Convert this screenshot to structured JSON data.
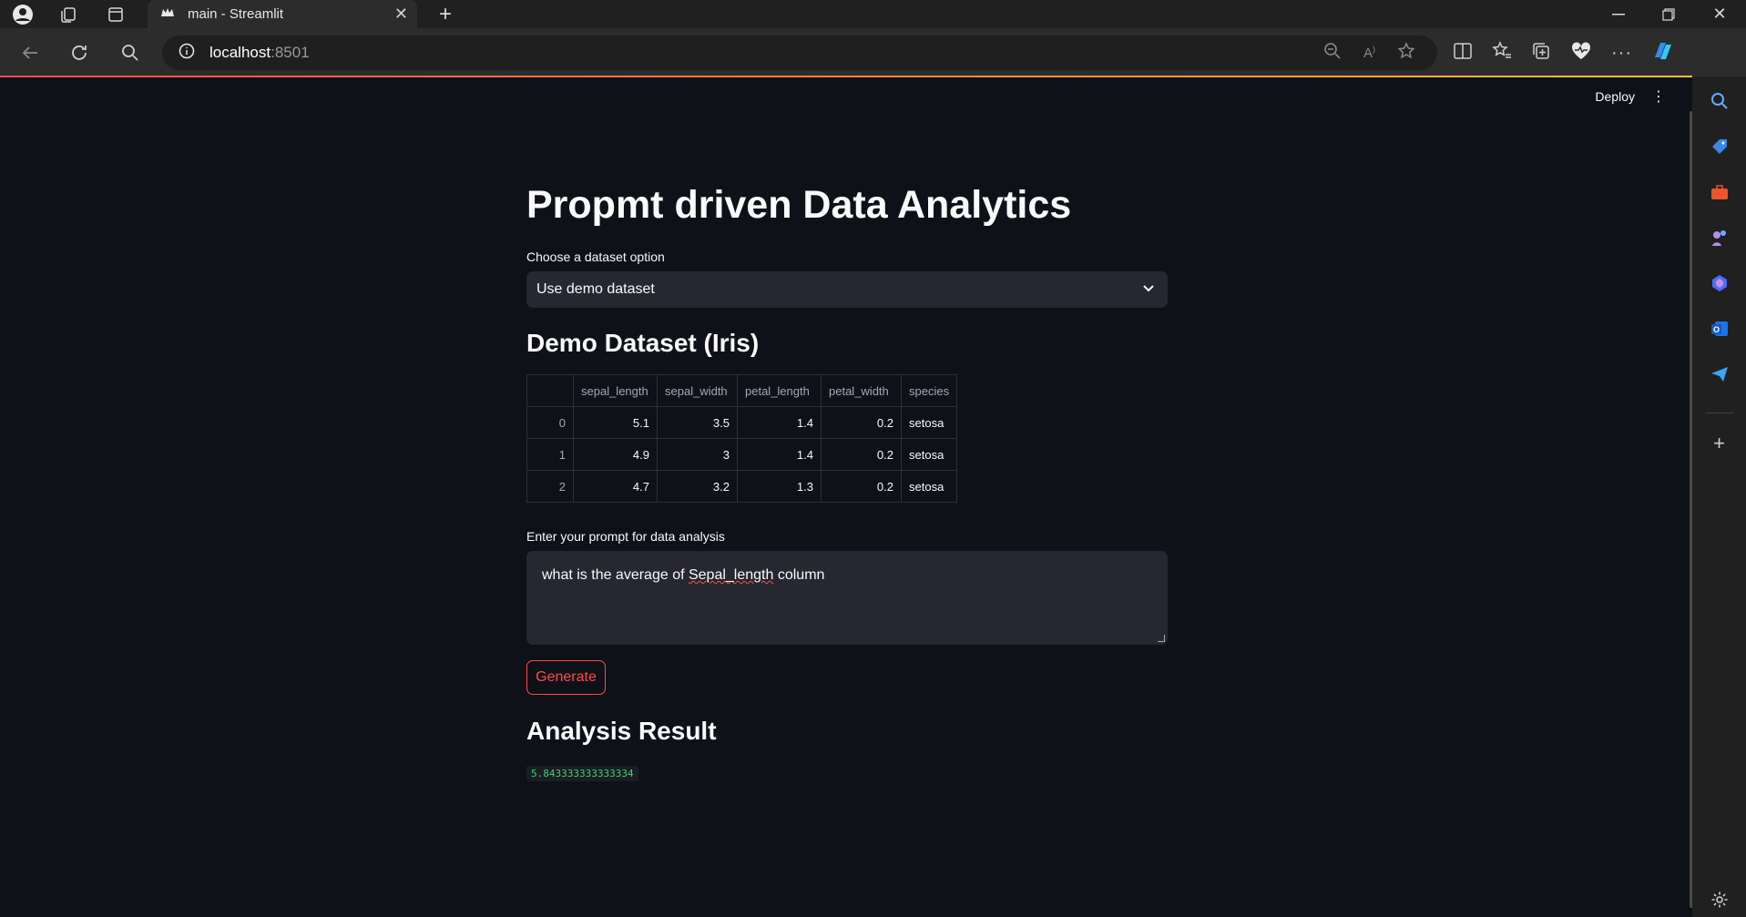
{
  "browser": {
    "tab_title": "main - Streamlit",
    "url_host": "localhost",
    "url_port": ":8501"
  },
  "app": {
    "deploy_label": "Deploy",
    "title": "Propmt driven Data Analytics",
    "dataset_label": "Choose a dataset option",
    "dataset_selected": "Use demo dataset",
    "demo_heading": "Demo Dataset (Iris)",
    "table": {
      "columns": [
        "",
        "sepal_length",
        "sepal_width",
        "petal_length",
        "petal_width",
        "species"
      ],
      "rows": [
        [
          "0",
          "5.1",
          "3.5",
          "1.4",
          "0.2",
          "setosa"
        ],
        [
          "1",
          "4.9",
          "3",
          "1.4",
          "0.2",
          "setosa"
        ],
        [
          "2",
          "4.7",
          "3.2",
          "1.3",
          "0.2",
          "setosa"
        ]
      ]
    },
    "prompt_label": "Enter your prompt for data analysis",
    "prompt_text_before": "what is the average of ",
    "prompt_text_misspelled": "Sepal_length",
    "prompt_text_after": " column",
    "generate_label": "Generate",
    "result_heading": "Analysis Result",
    "result_value": "5.843333333333334"
  },
  "colors": {
    "accent": "#ff4b4b",
    "result_green": "#3dd56d",
    "background": "#0e1117",
    "widget_bg": "#262730"
  }
}
